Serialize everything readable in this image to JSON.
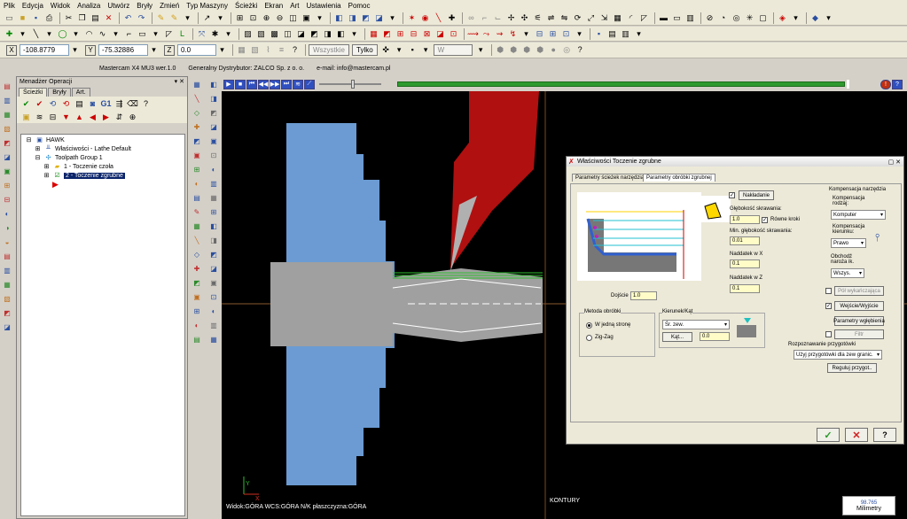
{
  "menu": [
    "Plik",
    "Edycja",
    "Widok",
    "Analiza",
    "Utwórz",
    "Bryły",
    "Zmień",
    "Typ Maszyny",
    "Ścieżki",
    "Ekran",
    "Art",
    "Ustawienia",
    "Pomoc"
  ],
  "coords": {
    "x": "-108.8779",
    "y": "-75.32886",
    "z_label": "Z",
    "z": "0.0"
  },
  "toolbar3": {
    "all_label": "Wszystkie",
    "only_label": "Tylko",
    "w_label": "W"
  },
  "info": {
    "version": "Mastercam X4 MU3 wer.1.0",
    "distributor": "Generalny Dystrybutor:  ZALCO Sp. z o. o.",
    "email": "e-mail:  info@mastercam.pl"
  },
  "opmgr": {
    "title": "Menadżer Operacji",
    "tabs": [
      "Ścieżki",
      "Bryły",
      "Art."
    ],
    "tree": {
      "machine": "HAWK",
      "properties": "Właściwości - Lathe Default",
      "group": "Toolpath Group 1",
      "op1": "1 - Toczenie czoła",
      "op2": "2 - Toczenie zgrubne"
    }
  },
  "dialog": {
    "title": "Właściwości Toczenie zgrubne",
    "tabs": [
      "Parametry ścieżek narzędzia",
      "Parametry obróbki zgrubnej"
    ],
    "overlap_btn": "Nakładanie",
    "depth_label": "Głębokość skrawania:",
    "depth_value": "1.0",
    "equal_steps": "Równe kroki",
    "min_depth_label": "Min. głębokość skrawania:",
    "min_depth_value": "0.01",
    "stock_x_label": "Naddatek w X",
    "stock_x_value": "0.1",
    "stock_z_label": "Naddatek w Z",
    "stock_z_value": "0.1",
    "entry_label": "Dojście",
    "entry_value": "1.0",
    "comp_title": "Kompensacja narzędzia",
    "comp_type_label": "Kompensacja rodzaj:",
    "comp_type_value": "Komputer",
    "comp_dir_label": "Kompensacja kierunku:",
    "comp_dir_value": "Prawo",
    "corner_label": "Obchodź naroża ik.",
    "corner_value": "Wszys.",
    "semi_finish": "Pół wykańczająca",
    "lead_inout": "Wejście/Wyjście",
    "plunge_params": "Parametry wgłębienia",
    "filter": "Filtr",
    "method_title": "Metoda obróbki",
    "method_one_way": "W jedną stronę",
    "method_zigzag": "Zig-Zag",
    "direction_title": "Kierunek/Kąt",
    "direction_value": "Śr. zew.",
    "angle_btn": "Kąt...",
    "angle_value": "0.0",
    "recognition_title": "Rozpoznawanie przygotówki",
    "recognition_value": "Użyj przygotówki dla zew granic.",
    "adjust_btn": "Reguluj przygot.."
  },
  "status": {
    "view": "Widok:GÓRA   WCS:GÓRA   N/K płaszczyzna:GÓRA",
    "contour": "KONTURY",
    "units": "Milimetry",
    "units_top": "98.765"
  },
  "colors": {
    "part": "#6b9bd2",
    "stock": "#a0a0a0",
    "tool": "#b01010",
    "dialog_bg": "#ece9d8"
  }
}
